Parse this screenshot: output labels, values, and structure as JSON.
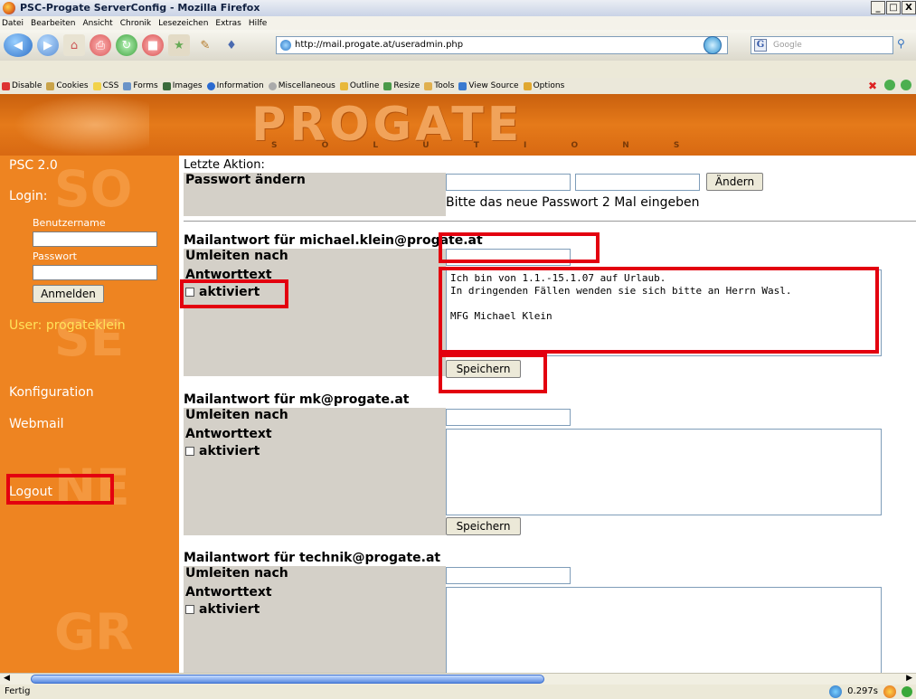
{
  "window": {
    "title": "PSC-Progate ServerConfig - Mozilla Firefox",
    "buttons": [
      "_",
      "□",
      "X"
    ]
  },
  "menubar": {
    "items": [
      "Datei",
      "Bearbeiten",
      "Ansicht",
      "Chronik",
      "Lesezeichen",
      "Extras",
      "Hilfe"
    ]
  },
  "navbar": {
    "url": "http://mail.progate.at/useradmin.php",
    "search_placeholder": "Google"
  },
  "devbar": {
    "items": [
      "Disable",
      "Cookies",
      "CSS",
      "Forms",
      "Images",
      "Information",
      "Miscellaneous",
      "Outline",
      "Resize",
      "Tools",
      "View Source",
      "Options"
    ]
  },
  "header": {
    "logo": "PROGATE",
    "tagline": "S O L U T I O N S"
  },
  "sidebar": {
    "version": "PSC 2.0",
    "login_label": "Login:",
    "username_label": "Benutzername",
    "password_label": "Passwort",
    "login_button": "Anmelden",
    "user_text": "User: progateklein",
    "konfiguration": "Konfiguration",
    "webmail": "Webmail",
    "logout": "Logout",
    "watermarks": [
      "SO",
      "SE",
      "NE",
      "GR"
    ]
  },
  "password": {
    "last_action_label": "Letzte Aktion:",
    "title": "Passwort ändern",
    "change_button": "Ändern",
    "hint": "Bitte das neue Passwort 2 Mal eingeben"
  },
  "mailreplies": [
    {
      "title": "Mailantwort für michael.klein@progate.at",
      "redirect_label": "Umleiten nach",
      "text_label": "Antworttext",
      "activated_label": "aktiviert",
      "text": "Ich bin von 1.1.-15.1.07 auf Urlaub.\nIn dringenden Fällen wenden sie sich bitte an Herrn Wasl.\n\nMFG Michael Klein",
      "save_button": "Speichern"
    },
    {
      "title": "Mailantwort für mk@progate.at",
      "redirect_label": "Umleiten nach",
      "text_label": "Antworttext",
      "activated_label": "aktiviert",
      "text": "",
      "save_button": "Speichern"
    },
    {
      "title": "Mailantwort für technik@progate.at",
      "redirect_label": "Umleiten nach",
      "text_label": "Antworttext",
      "activated_label": "aktiviert",
      "text": ""
    }
  ],
  "status": {
    "left": "Fertig",
    "time": "0.297s"
  },
  "colors": {
    "sidebar": "#ee8421",
    "header": "#e57a1a",
    "highlight": "#e3000f",
    "form_grey": "#d4d0c8"
  }
}
